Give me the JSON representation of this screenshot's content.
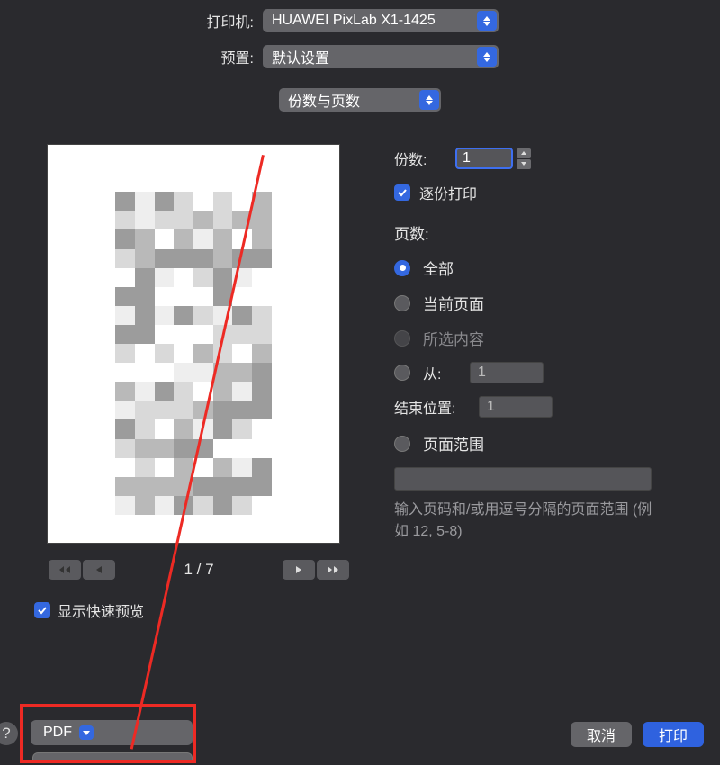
{
  "top": {
    "printer_label": "打印机:",
    "printer_value": "HUAWEI PixLab X1-1425",
    "preset_label": "预置:",
    "preset_value": "默认设置"
  },
  "section_select": "份数与页数",
  "copies": {
    "label": "份数:",
    "value": "1",
    "collate_label": "逐份打印"
  },
  "pages": {
    "header": "页数:",
    "all": "全部",
    "current": "当前页面",
    "selection": "所选内容",
    "from_label": "从:",
    "from_value": "1",
    "to_label": "结束位置:",
    "to_value": "1",
    "range_label": "页面范围",
    "hint": "输入页码和/或用逗号分隔的页面范围 (例如 12, 5-8)"
  },
  "preview": {
    "counter": "1 / 7",
    "show_quick": "显示快速预览"
  },
  "footer": {
    "pdf": "PDF",
    "cancel": "取消",
    "print": "打印",
    "help": "?"
  }
}
